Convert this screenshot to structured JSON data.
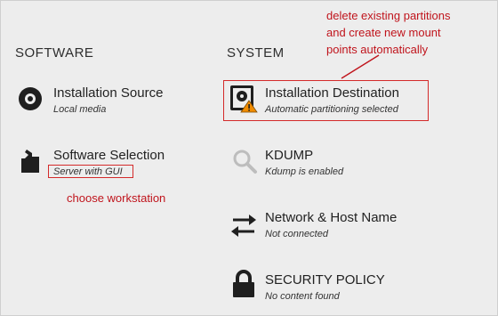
{
  "sections": {
    "software": "SOFTWARE",
    "system": "SYSTEM"
  },
  "spokes": {
    "installation_source": {
      "title": "Installation Source",
      "status": "Local media",
      "icon": "disc-icon"
    },
    "software_selection": {
      "title": "Software Selection",
      "status": "Server with GUI",
      "icon": "package-icon"
    },
    "installation_destination": {
      "title": "Installation Destination",
      "status": "Automatic partitioning selected",
      "icon": "hard-drive-warning-icon"
    },
    "kdump": {
      "title": "KDUMP",
      "status": "Kdump is enabled",
      "icon": "search-icon"
    },
    "network": {
      "title": "Network & Host Name",
      "status": "Not connected",
      "icon": "network-arrows-icon"
    },
    "security": {
      "title": "SECURITY POLICY",
      "status": "No content found",
      "icon": "lock-icon"
    }
  },
  "annotations": {
    "destination_note": [
      "delete existing partitions",
      "and create new mount",
      "points automatically"
    ],
    "software_note": "choose workstation"
  },
  "colors": {
    "background": "#ededed",
    "annotation": "#c0141c",
    "warning": "#f08c00"
  }
}
